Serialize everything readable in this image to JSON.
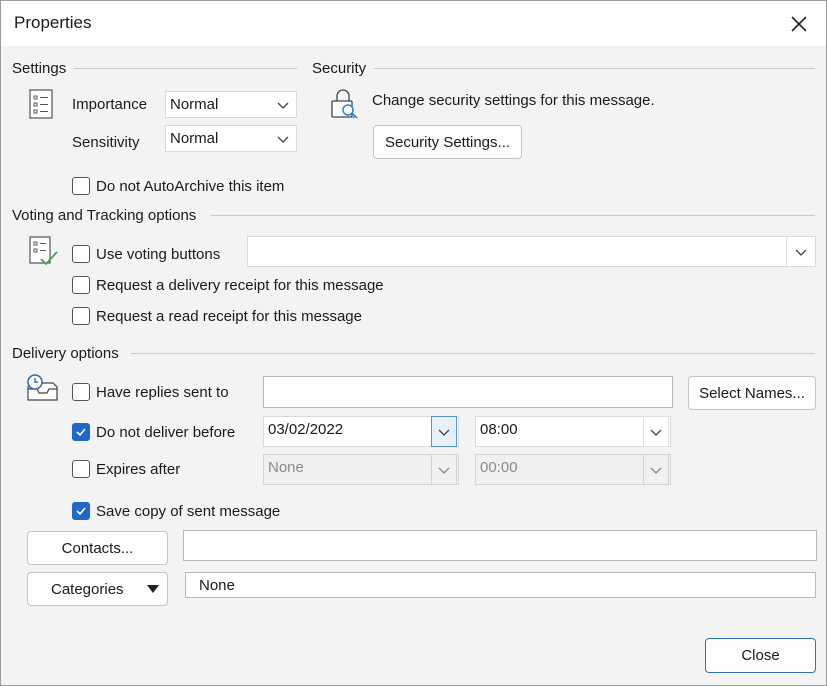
{
  "window": {
    "title": "Properties",
    "close_icon": "close-icon"
  },
  "settings": {
    "heading": "Settings",
    "importance_label": "Importance",
    "importance_value": "Normal",
    "sensitivity_label": "Sensitivity",
    "sensitivity_value": "Normal",
    "autoarchive_label": "Do not AutoArchive this item",
    "autoarchive_checked": false
  },
  "security": {
    "heading": "Security",
    "description": "Change security settings for this message.",
    "button_label": "Security Settings..."
  },
  "voting": {
    "heading": "Voting and Tracking options",
    "use_voting_label": "Use voting buttons",
    "use_voting_checked": false,
    "voting_value": "",
    "delivery_receipt_label": "Request a delivery receipt for this message",
    "delivery_receipt_checked": false,
    "read_receipt_label": "Request a read receipt for this message",
    "read_receipt_checked": false
  },
  "delivery": {
    "heading": "Delivery options",
    "replies_label": "Have replies sent to",
    "replies_checked": false,
    "replies_value": "",
    "select_names_label": "Select Names...",
    "deliver_before_label": "Do not deliver before",
    "deliver_before_checked": true,
    "deliver_date": "03/02/2022",
    "deliver_time": "08:00",
    "expires_label": "Expires after",
    "expires_checked": false,
    "expires_date": "None",
    "expires_time": "00:00",
    "save_copy_label": "Save copy of sent message",
    "save_copy_checked": true
  },
  "contacts": {
    "button_label": "Contacts...",
    "value": ""
  },
  "categories": {
    "button_label": "Categories",
    "value": "None"
  },
  "footer": {
    "close_label": "Close"
  },
  "colors": {
    "accent": "#1f68c4",
    "title_bg": "#ffffff",
    "dialog_bg": "#f3f3f3"
  }
}
